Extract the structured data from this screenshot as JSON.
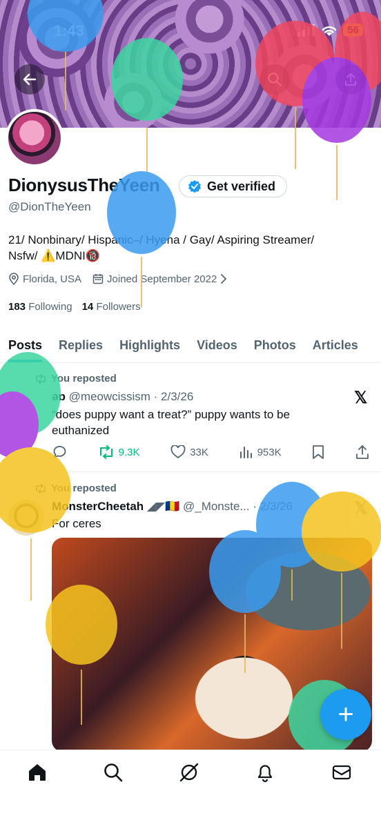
{
  "status_bar": {
    "time": "1:43",
    "battery": "56"
  },
  "profile": {
    "display_name": "DionysusTheYeen",
    "handle": "@DionTheYeen",
    "verify_label": "Get verified",
    "bio_line1": "21/ Nonbinary/ Hispanic–/ Hyena / Gay/ Aspiring Streamer/",
    "bio_line2_prefix": "Nsfw/ ",
    "bio_warning_emoji": "⚠️",
    "bio_mdni": "MDNI",
    "bio_18_emoji": "🔞",
    "location": "Florida, USA",
    "joined": "Joined September 2022",
    "following_count": "183",
    "following_label": "Following",
    "followers_count": "14",
    "followers_label": "Followers"
  },
  "tabs": [
    {
      "label": "Posts"
    },
    {
      "label": "Replies"
    },
    {
      "label": "Highlights"
    },
    {
      "label": "Videos"
    },
    {
      "label": "Photos"
    },
    {
      "label": "Articles"
    }
  ],
  "posts": [
    {
      "repost_label": "You reposted",
      "author_handle": "@meowcissism",
      "author_prefix": "əɒ",
      "date": "· 2/3/26",
      "text_line1": "“does puppy want a treat?”  puppy wants to be",
      "text_line2": "euthanized",
      "reposts": "9.3K",
      "likes": "33K",
      "views": "953K"
    },
    {
      "repost_label": "You reposted",
      "author_name": "MonsterCheetah",
      "author_flags": "◢◤🇷🇴",
      "author_handle": "@_Monste...",
      "date": "· 2/3/26",
      "text": "For ceres"
    }
  ],
  "fab_label": "+",
  "colors": {
    "accent": "#1d9bf0",
    "repost_green": "#00ba7c",
    "muted": "#536471"
  }
}
